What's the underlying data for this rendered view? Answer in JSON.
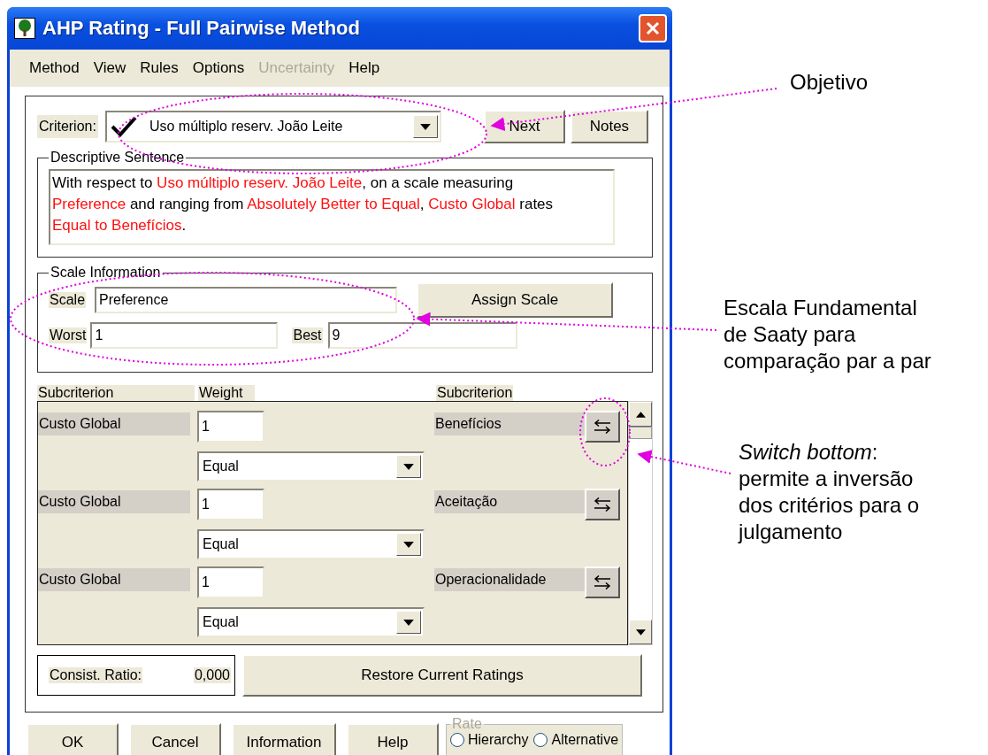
{
  "window": {
    "title": "AHP Rating - Full Pairwise Method"
  },
  "menu": [
    {
      "label": "Method",
      "disabled": false
    },
    {
      "label": "View",
      "disabled": false
    },
    {
      "label": "Rules",
      "disabled": false
    },
    {
      "label": "Options",
      "disabled": false
    },
    {
      "label": "Uncertainty",
      "disabled": true
    },
    {
      "label": "Help",
      "disabled": false
    }
  ],
  "criterion": {
    "label": "Criterion:",
    "value": "Uso múltiplo reserv. João Leite",
    "checked": true
  },
  "top_buttons": [
    "Next",
    "Notes"
  ],
  "descriptive_sentence": {
    "title": "Descriptive Sentence",
    "segments": [
      {
        "text": "With respect to ",
        "highlight": false
      },
      {
        "text": "Uso múltiplo reserv. João Leite",
        "highlight": true
      },
      {
        "text": ", on a scale measuring ",
        "highlight": false
      },
      {
        "text": "Preference",
        "highlight": true
      },
      {
        "text": " and ranging from ",
        "highlight": false
      },
      {
        "text": "Absolutely Better to Equal",
        "highlight": true
      },
      {
        "text": ", ",
        "highlight": false
      },
      {
        "text": "Custo Global",
        "highlight": true
      },
      {
        "text": " rates ",
        "highlight": false
      },
      {
        "text": "Equal to Benefícios",
        "highlight": true
      },
      {
        "text": ".",
        "highlight": false
      }
    ]
  },
  "scale_information": {
    "title": "Scale Information",
    "scale_label": "Scale",
    "scale": "Preference",
    "worst_label": "Worst",
    "worst": "1",
    "best_label": "Best",
    "best": "9",
    "assign_button": "Assign Scale"
  },
  "columns": [
    "Subcriterion",
    "Weight",
    "Subcriterion"
  ],
  "rows": [
    {
      "left": "Custo Global",
      "weight": "1",
      "verbal": "Equal",
      "right": "Benefícios"
    },
    {
      "left": "Custo Global",
      "weight": "1",
      "verbal": "Equal",
      "right": "Aceitação"
    },
    {
      "left": "Custo Global",
      "weight": "1",
      "verbal": "Equal",
      "right": "Operacionalidade"
    }
  ],
  "consistency": {
    "label": "Consist. Ratio:",
    "value": "0,000"
  },
  "restore_button": "Restore Current Ratings",
  "bottom_buttons": [
    "OK",
    "Cancel",
    "Information",
    "Help"
  ],
  "rate": {
    "title": "Rate",
    "options": [
      {
        "label": "Hierarchy",
        "selected": false
      },
      {
        "label": "Alternative",
        "selected": false
      }
    ]
  },
  "annotations": [
    {
      "lines": [
        "Objetivo"
      ]
    },
    {
      "lines": [
        "Escala Fundamental",
        "de Saaty para",
        "comparação par a par"
      ]
    },
    {
      "lines": [
        "*Switch bottom*:",
        "permite a inversão",
        "dos critérios para o",
        "julgamento"
      ]
    }
  ]
}
